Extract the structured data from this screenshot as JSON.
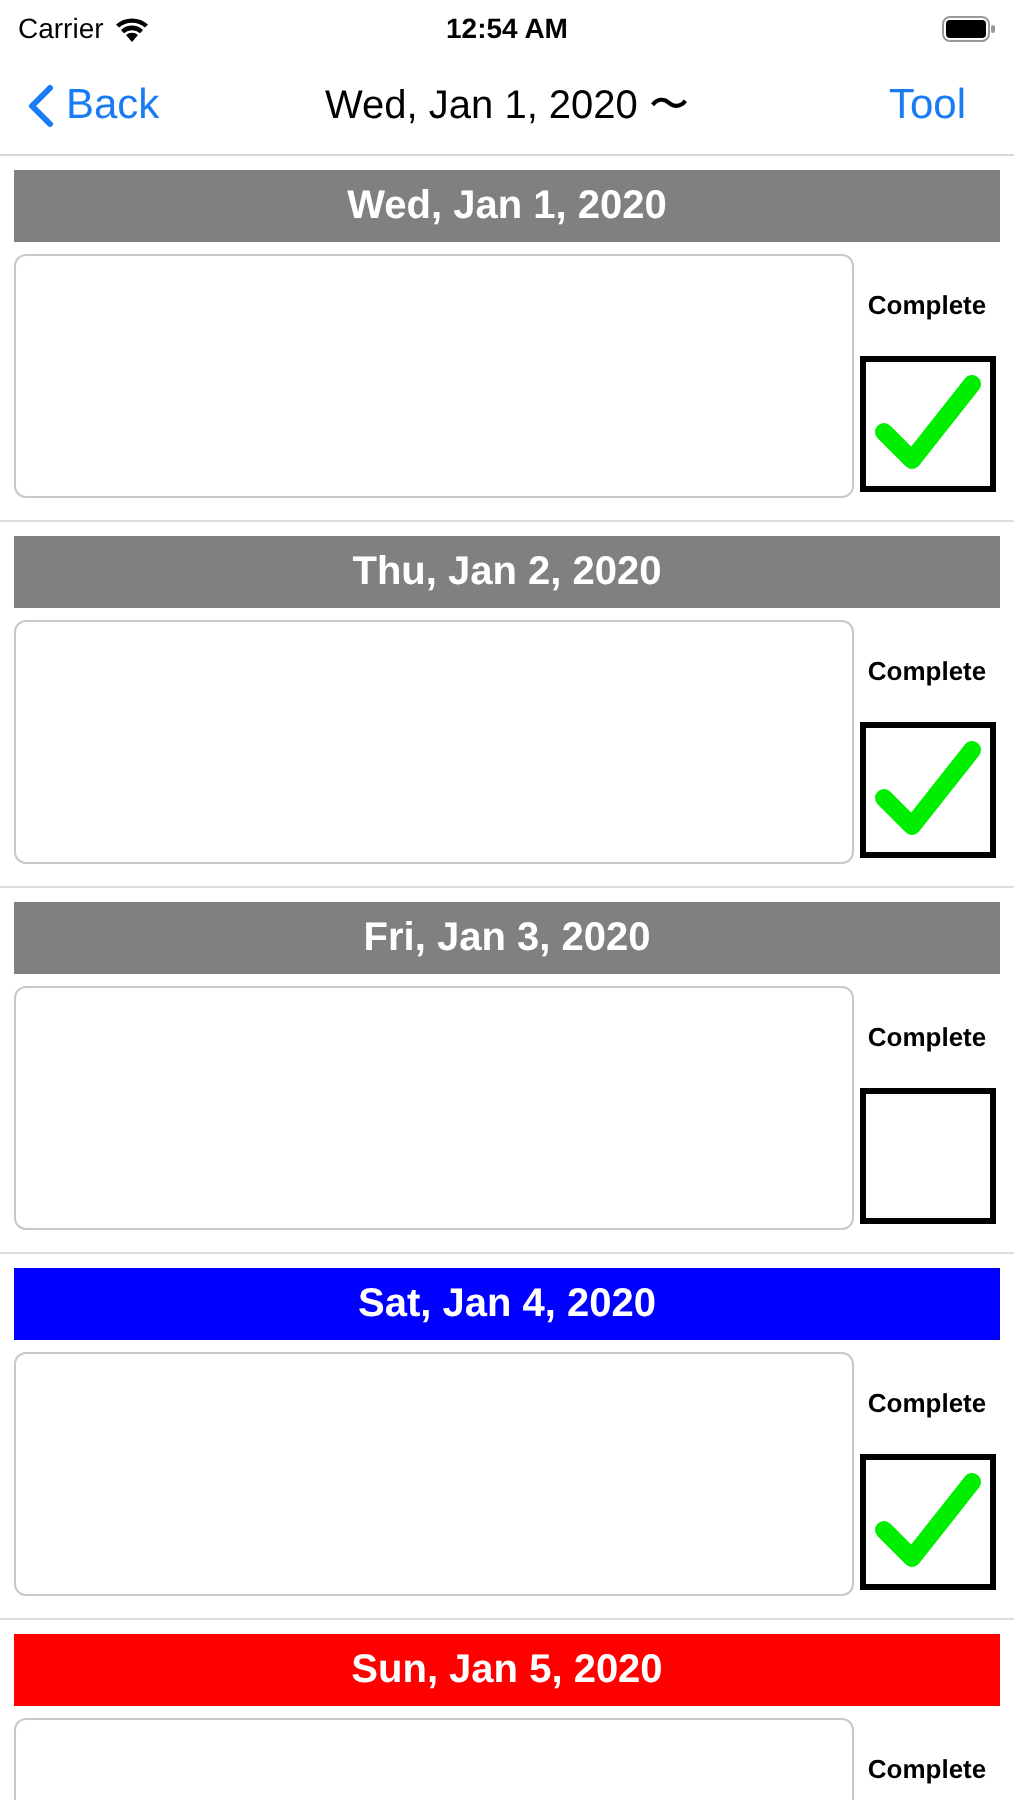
{
  "status_bar": {
    "carrier": "Carrier",
    "time": "12:54 AM"
  },
  "nav": {
    "back": "Back",
    "title": "Wed, Jan 1, 2020 〜",
    "action": "Tool"
  },
  "days": [
    {
      "date": "Wed, Jan 1, 2020",
      "color": "#808080",
      "label": "Complete",
      "checked": true
    },
    {
      "date": "Thu, Jan 2, 2020",
      "color": "#808080",
      "label": "Complete",
      "checked": true
    },
    {
      "date": "Fri, Jan 3, 2020",
      "color": "#808080",
      "label": "Complete",
      "checked": false
    },
    {
      "date": "Sat, Jan 4, 2020",
      "color": "#0000ff",
      "label": "Complete",
      "checked": true
    },
    {
      "date": "Sun, Jan 5, 2020",
      "color": "#ff0000",
      "label": "Complete"
    }
  ]
}
